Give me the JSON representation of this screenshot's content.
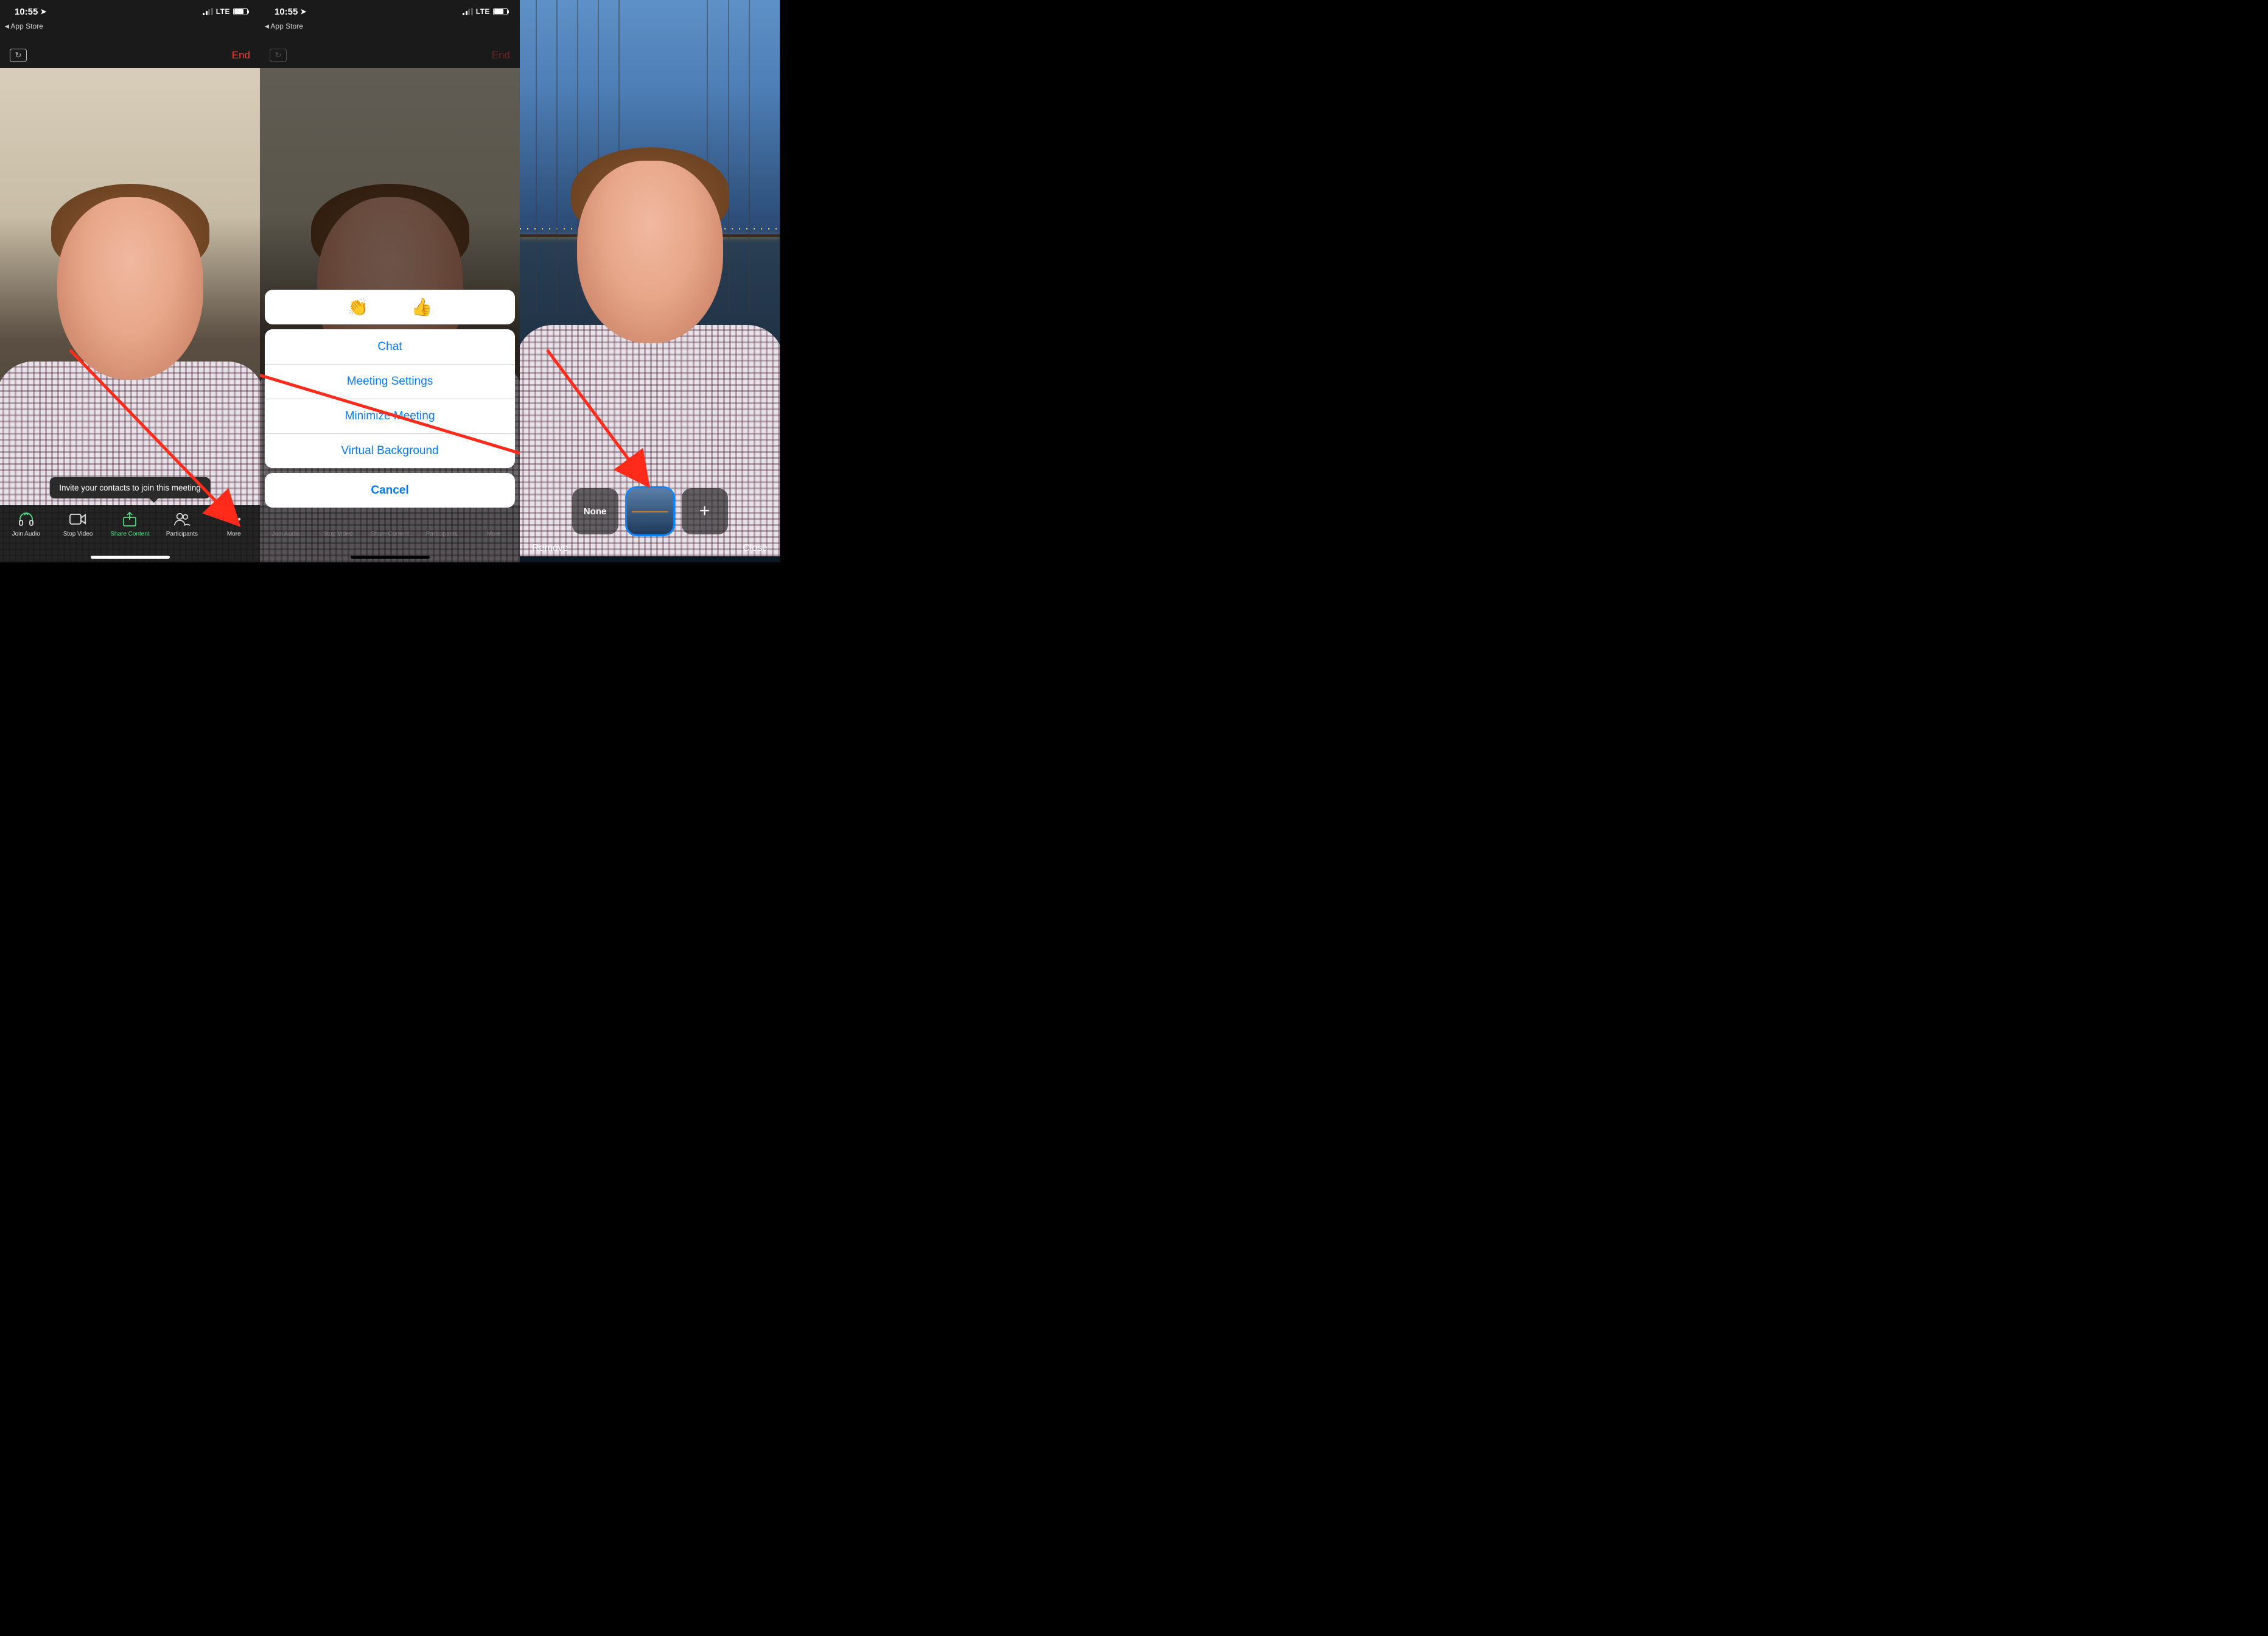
{
  "status": {
    "time": "10:55",
    "carrier": "LTE",
    "breadcrumb": "App Store"
  },
  "topbar": {
    "end": "End"
  },
  "tooltip": "Invite your contacts to join this meeting",
  "toolbar": {
    "join_audio": "Join Audio",
    "stop_video": "Stop Video",
    "share_content": "Share Content",
    "participants": "Participants",
    "more": "More"
  },
  "sheet": {
    "emoji_clap": "👏",
    "emoji_thumb": "👍",
    "chat": "Chat",
    "meeting_settings": "Meeting Settings",
    "minimize": "Minimize Meeting",
    "virtual_bg": "Virtual Background",
    "cancel": "Cancel"
  },
  "bg_picker": {
    "none": "None",
    "plus": "+",
    "remove": "Remove",
    "close": "Close"
  }
}
